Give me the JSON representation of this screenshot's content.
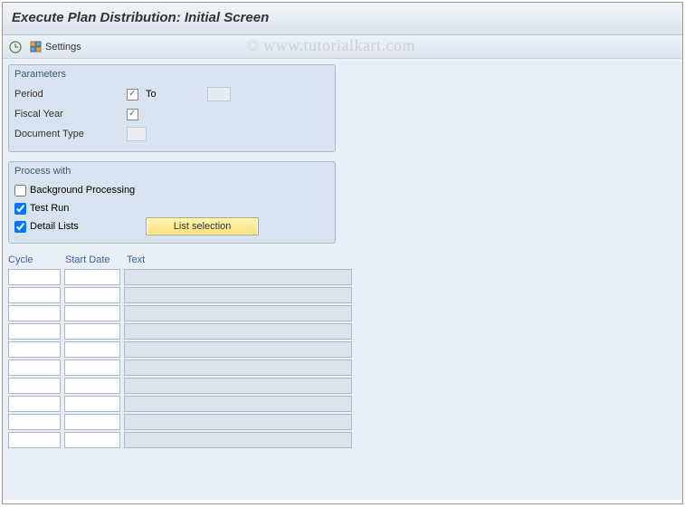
{
  "title": "Execute Plan Distribution: Initial Screen",
  "watermark": "© www.tutorialkart.com",
  "toolbar": {
    "settings_label": "Settings"
  },
  "parameters": {
    "group_title": "Parameters",
    "period_label": "Period",
    "to_label": "To",
    "fiscal_year_label": "Fiscal Year",
    "doc_type_label": "Document Type",
    "period_from": "",
    "period_to": "",
    "fiscal_year": "",
    "doc_type": ""
  },
  "process": {
    "group_title": "Process with",
    "bg_label": "Background Processing",
    "bg_checked": false,
    "test_label": "Test Run",
    "test_checked": true,
    "detail_label": "Detail Lists",
    "detail_checked": true,
    "list_sel_btn": "List selection"
  },
  "table": {
    "col_cycle": "Cycle",
    "col_start": "Start Date",
    "col_text": "Text",
    "rows": [
      {
        "cycle": "",
        "start": "",
        "text": ""
      },
      {
        "cycle": "",
        "start": "",
        "text": ""
      },
      {
        "cycle": "",
        "start": "",
        "text": ""
      },
      {
        "cycle": "",
        "start": "",
        "text": ""
      },
      {
        "cycle": "",
        "start": "",
        "text": ""
      },
      {
        "cycle": "",
        "start": "",
        "text": ""
      },
      {
        "cycle": "",
        "start": "",
        "text": ""
      },
      {
        "cycle": "",
        "start": "",
        "text": ""
      },
      {
        "cycle": "",
        "start": "",
        "text": ""
      },
      {
        "cycle": "",
        "start": "",
        "text": ""
      }
    ]
  }
}
